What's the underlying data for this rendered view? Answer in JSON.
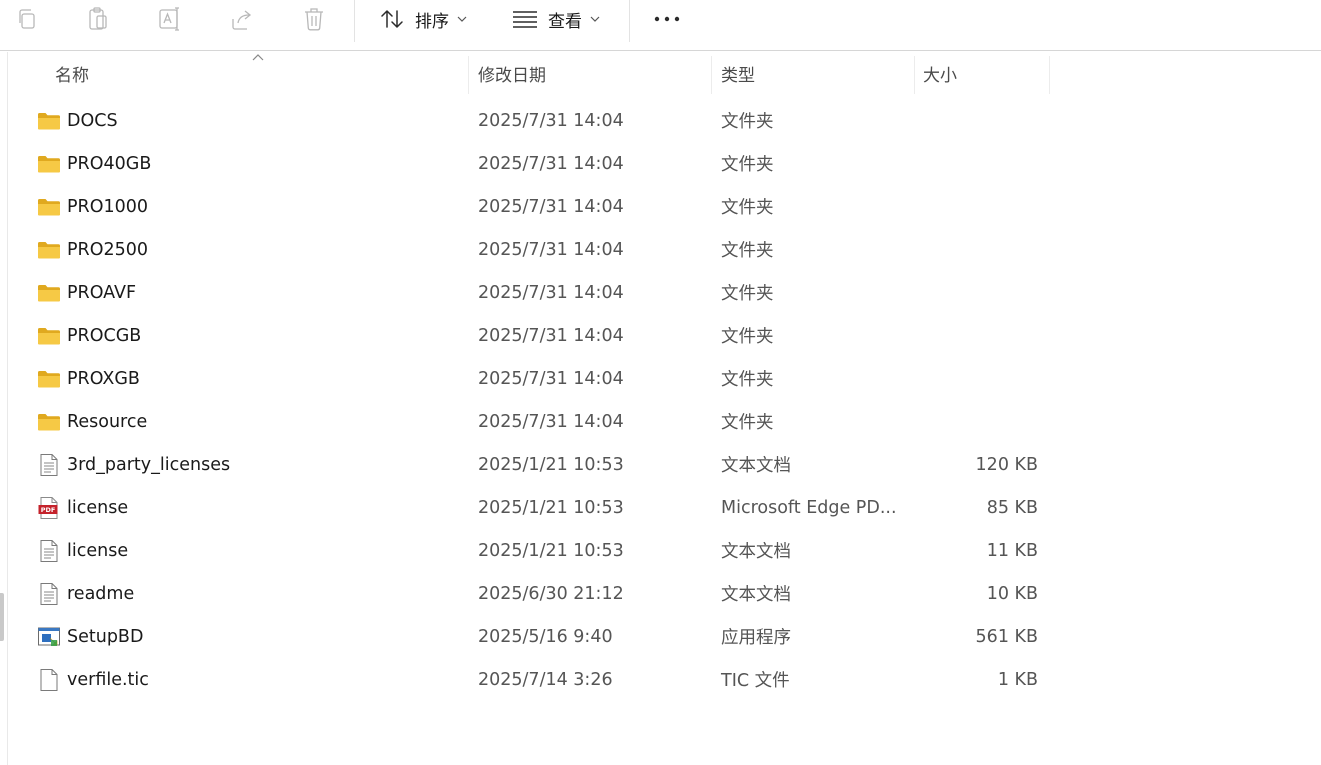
{
  "toolbar": {
    "sort_label": "排序",
    "view_label": "查看",
    "more_glyph": "•••"
  },
  "columns": {
    "name": "名称",
    "modified": "修改日期",
    "type": "类型",
    "size": "大小"
  },
  "files": [
    {
      "name": "DOCS",
      "modified": "2025/7/31 14:04",
      "type": "文件夹",
      "size": "",
      "icon": "folder-icon"
    },
    {
      "name": "PRO40GB",
      "modified": "2025/7/31 14:04",
      "type": "文件夹",
      "size": "",
      "icon": "folder-icon"
    },
    {
      "name": "PRO1000",
      "modified": "2025/7/31 14:04",
      "type": "文件夹",
      "size": "",
      "icon": "folder-icon"
    },
    {
      "name": "PRO2500",
      "modified": "2025/7/31 14:04",
      "type": "文件夹",
      "size": "",
      "icon": "folder-icon"
    },
    {
      "name": "PROAVF",
      "modified": "2025/7/31 14:04",
      "type": "文件夹",
      "size": "",
      "icon": "folder-icon"
    },
    {
      "name": "PROCGB",
      "modified": "2025/7/31 14:04",
      "type": "文件夹",
      "size": "",
      "icon": "folder-icon"
    },
    {
      "name": "PROXGB",
      "modified": "2025/7/31 14:04",
      "type": "文件夹",
      "size": "",
      "icon": "folder-icon"
    },
    {
      "name": "Resource",
      "modified": "2025/7/31 14:04",
      "type": "文件夹",
      "size": "",
      "icon": "folder-icon"
    },
    {
      "name": "3rd_party_licenses",
      "modified": "2025/1/21 10:53",
      "type": "文本文档",
      "size": "120 KB",
      "icon": "text-document-icon"
    },
    {
      "name": "license",
      "modified": "2025/1/21 10:53",
      "type": "Microsoft Edge PD...",
      "size": "85 KB",
      "icon": "pdf-icon"
    },
    {
      "name": "license",
      "modified": "2025/1/21 10:53",
      "type": "文本文档",
      "size": "11 KB",
      "icon": "text-document-icon"
    },
    {
      "name": "readme",
      "modified": "2025/6/30 21:12",
      "type": "文本文档",
      "size": "10 KB",
      "icon": "text-document-icon"
    },
    {
      "name": "SetupBD",
      "modified": "2025/5/16 9:40",
      "type": "应用程序",
      "size": "561 KB",
      "icon": "application-icon"
    },
    {
      "name": "verfile.tic",
      "modified": "2025/7/14 3:26",
      "type": "TIC 文件",
      "size": "1 KB",
      "icon": "blank-file-icon"
    }
  ],
  "colors": {
    "folder": "#f3c33f",
    "folder_dark": "#e0a91f",
    "pdf_red": "#c4222b",
    "toolbar_disabled": "#b8b8b8"
  }
}
